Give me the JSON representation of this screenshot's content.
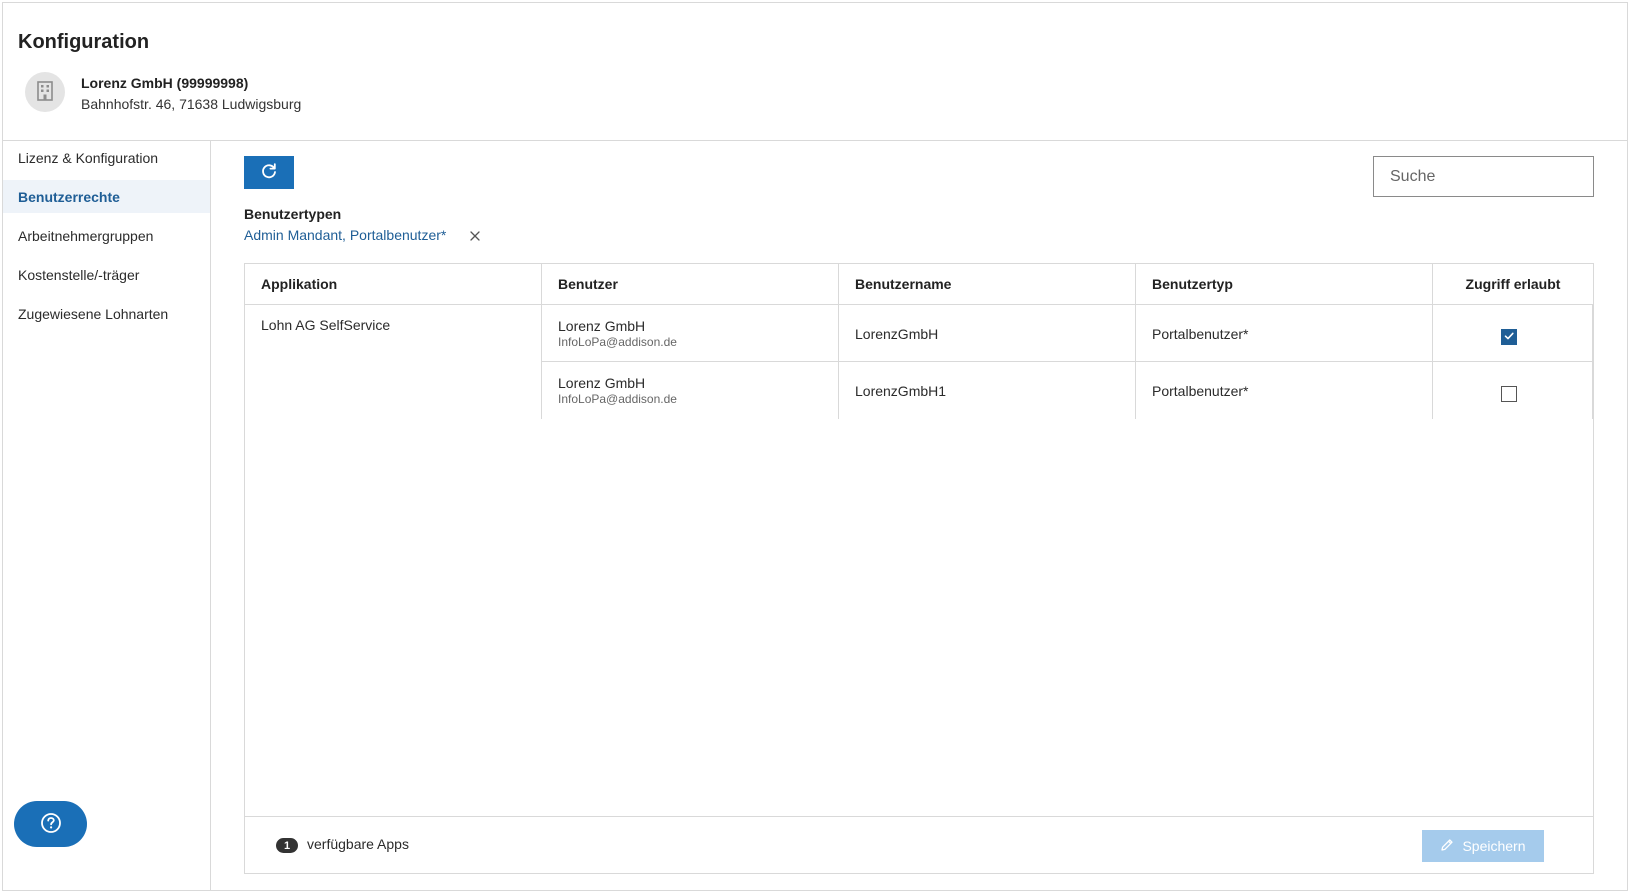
{
  "header": {
    "title": "Konfiguration",
    "company_name": "Lorenz GmbH (99999998)",
    "company_address": "Bahnhofstr. 46, 71638 Ludwigsburg",
    "company_icon": "building-icon"
  },
  "sidebar": {
    "items": [
      {
        "label": "Lizenz & Konfiguration",
        "active": false
      },
      {
        "label": "Benutzerrechte",
        "active": true
      },
      {
        "label": "Arbeitnehmergruppen",
        "active": false
      },
      {
        "label": "Kostenstelle/-träger",
        "active": false
      },
      {
        "label": "Zugewiesene Lohnarten",
        "active": false
      }
    ],
    "help_icon": "help-circle-icon"
  },
  "toolbar": {
    "refresh_icon": "refresh-icon",
    "search_placeholder": "Suche"
  },
  "filter": {
    "label": "Benutzertypen",
    "value": "Admin Mandant, Portalbenutzer*",
    "clear_icon": "close-icon"
  },
  "table": {
    "columns": [
      "Applikation",
      "Benutzer",
      "Benutzername",
      "Benutzertyp",
      "Zugriff erlaubt"
    ],
    "application": "Lohn AG SelfService",
    "rows": [
      {
        "user_name": "Lorenz GmbH",
        "user_email": "InfoLoPa@addison.de",
        "username": "LorenzGmbH",
        "user_type": "Portalbenutzer*",
        "access_allowed": true
      },
      {
        "user_name": "Lorenz GmbH",
        "user_email": "InfoLoPa@addison.de",
        "username": "LorenzGmbH1",
        "user_type": "Portalbenutzer*",
        "access_allowed": false
      }
    ]
  },
  "footer": {
    "apps_count": "1",
    "apps_label": "verfügbare Apps",
    "save_label": "Speichern",
    "save_icon": "pencil-icon",
    "save_enabled": false
  },
  "colors": {
    "accent": "#1a6fb7",
    "active_nav_text": "#1f5e96",
    "active_nav_bg": "#eef3f9",
    "disabled_button": "#a5cbec"
  }
}
